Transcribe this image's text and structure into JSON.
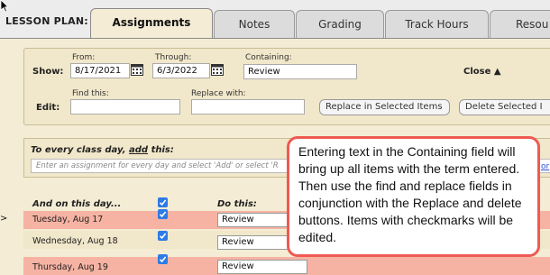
{
  "header": {
    "lesson_plan_label": "LESSON PLAN:",
    "tabs": [
      {
        "label": "Assignments",
        "active": true
      },
      {
        "label": "Notes",
        "active": false
      },
      {
        "label": "Grading",
        "active": false
      },
      {
        "label": "Track Hours",
        "active": false
      },
      {
        "label": "Resou",
        "active": false
      }
    ]
  },
  "show_row": {
    "show_label": "Show:",
    "from_label": "From:",
    "from_value": "8/17/2021",
    "through_label": "Through:",
    "through_value": "6/3/2022",
    "containing_label": "Containing:",
    "containing_value": "Review",
    "close_label": "Close ▲"
  },
  "edit_row": {
    "edit_label": "Edit:",
    "find_label": "Find this:",
    "find_value": "",
    "replace_label": "Replace with:",
    "replace_value": "",
    "replace_button": "Replace in Selected Items",
    "delete_button": "Delete Selected I"
  },
  "every_day": {
    "title_prefix": "To every class day, ",
    "title_link": "add",
    "title_suffix": " this:",
    "placeholder": "Enter an assignment for every day and select 'Add' or select 'R",
    "or_link": "or"
  },
  "grid": {
    "col_day": "And on this day...",
    "col_do": "Do this:",
    "rows": [
      {
        "arrow": ">",
        "day": "Tuesday, Aug 17",
        "checked": true,
        "value": "Review",
        "highlight": true
      },
      {
        "arrow": "",
        "day": "Wednesday, Aug 18",
        "checked": true,
        "value": "Review",
        "highlight": false
      },
      {
        "arrow": "",
        "day": "Thursday, Aug 19",
        "checked": true,
        "value": "Review",
        "highlight": true
      }
    ]
  },
  "callout_text": "Entering text in the Containing field will bring up all items with the term entered. Then use the find and replace fields in conjunction with the Replace and delete buttons. Items with checkmarks will be edited.",
  "colors": {
    "panel": "#f4ecd4",
    "highlight_row": "#f6b3a3",
    "checkbox": "#2e7ae6",
    "callout_border": "#ee5a52"
  }
}
